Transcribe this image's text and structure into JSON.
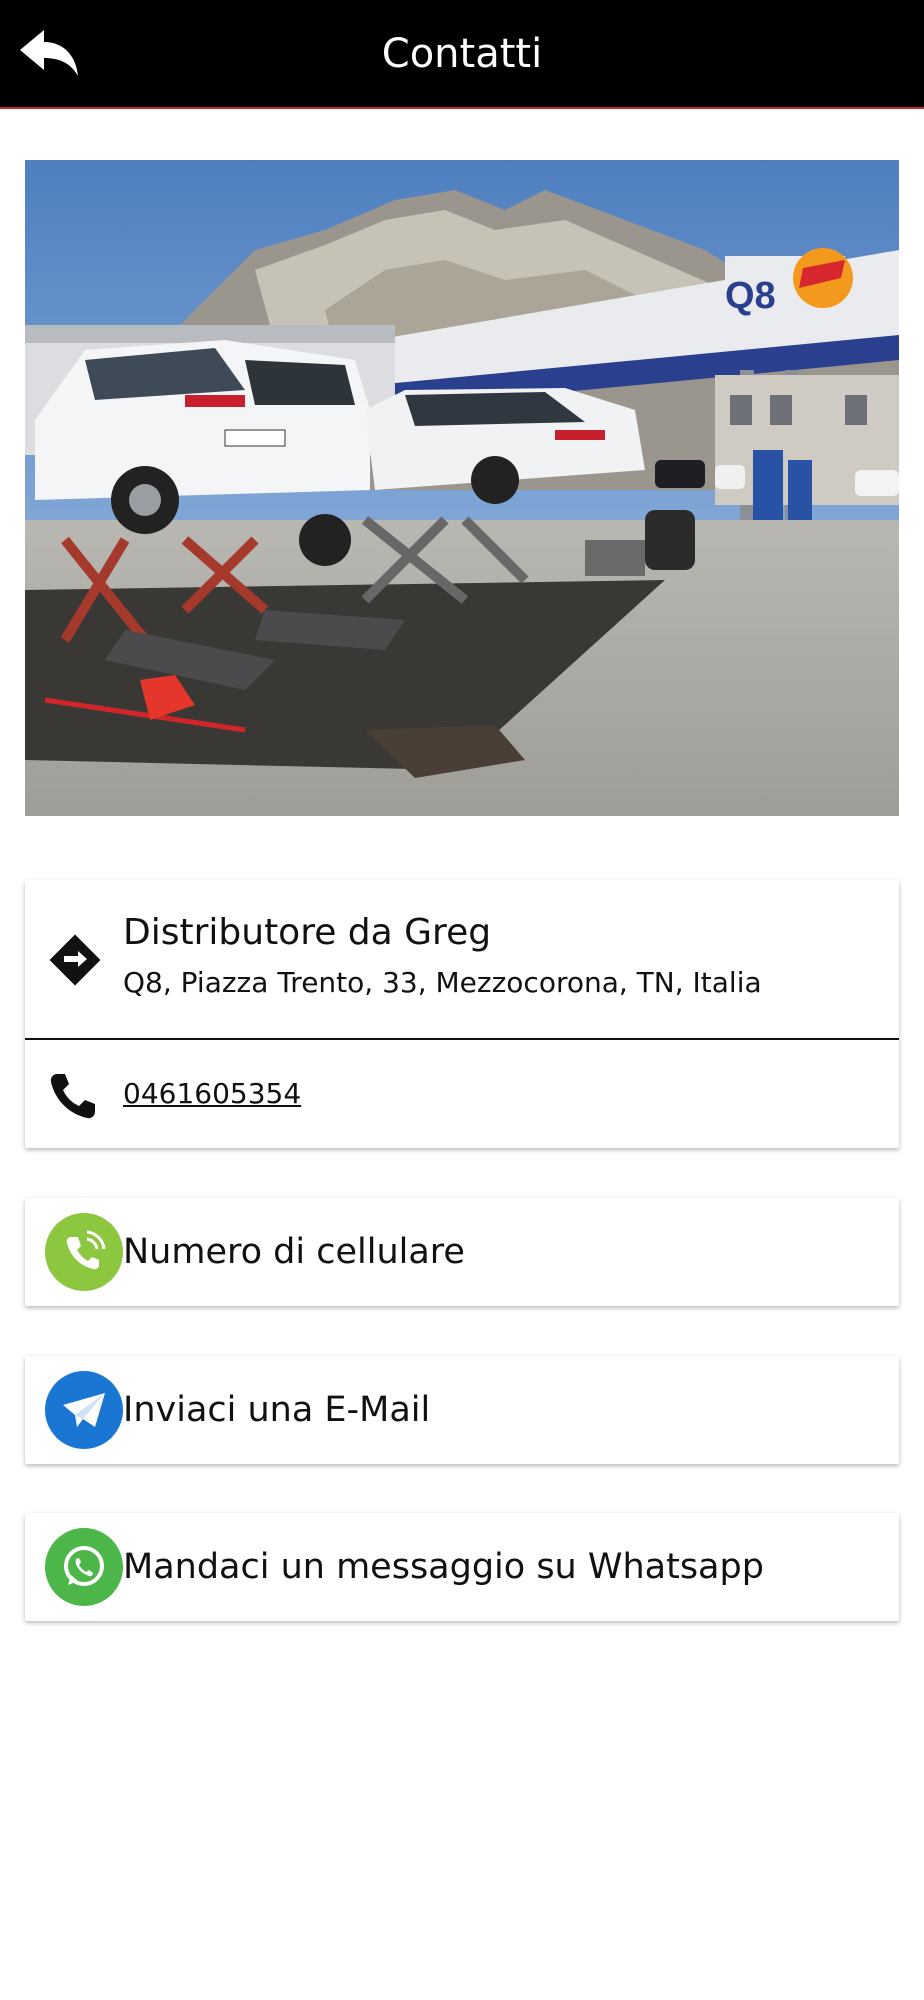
{
  "header": {
    "title": "Contatti",
    "back_icon": "reply-arrow-icon",
    "background": "#000000",
    "accent_line": "#c1272d"
  },
  "hero_image": {
    "description_icon": "photo-gas-station"
  },
  "address_card": {
    "icon": "directions-icon",
    "name": "Distributore da Greg",
    "address": "Q8, Piazza Trento, 33, Mezzocorona, TN, Italia"
  },
  "phone": {
    "icon": "phone-icon",
    "number": "0461605354"
  },
  "actions": [
    {
      "icon": "mobile-call-icon",
      "label": "Numero di cellulare",
      "color": "#8dc63f"
    },
    {
      "icon": "email-icon",
      "label": "Inviaci una E-Mail",
      "color": "#1976d2"
    },
    {
      "icon": "whatsapp-icon",
      "label": "Mandaci un messaggio su Whatsapp",
      "color": "#4cb648"
    }
  ]
}
